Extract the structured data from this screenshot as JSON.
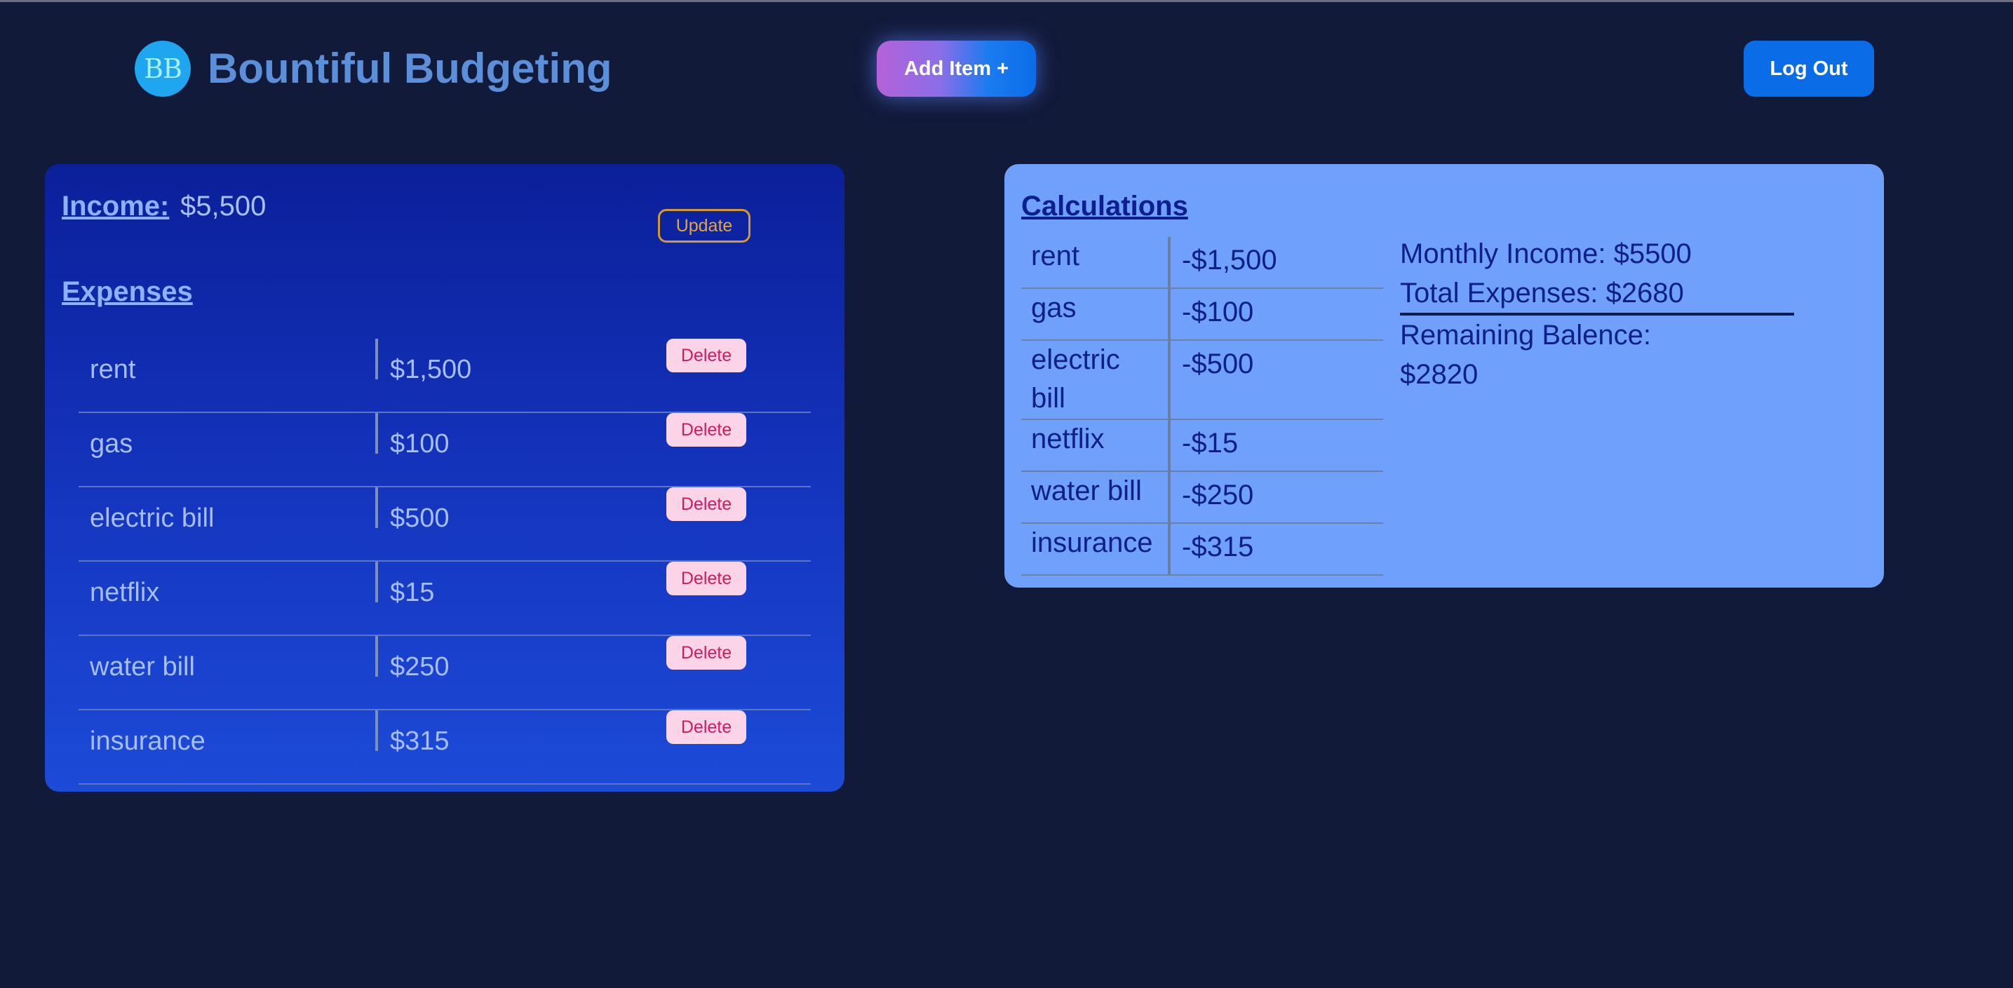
{
  "header": {
    "logo_initials": "BB",
    "title": "Bountiful Budgeting",
    "add_item_label": "Add Item +",
    "logout_label": "Log Out"
  },
  "expenses_panel": {
    "income_label": "Income:",
    "income_value": "$5,500",
    "update_label": "Update",
    "expenses_heading": "Expenses",
    "delete_label": "Delete",
    "items": [
      {
        "name": "rent",
        "amount": "$1,500"
      },
      {
        "name": "gas",
        "amount": "$100"
      },
      {
        "name": "electric bill",
        "amount": "$500"
      },
      {
        "name": "netflix",
        "amount": "$15"
      },
      {
        "name": "water bill",
        "amount": "$250"
      },
      {
        "name": "insurance",
        "amount": "$315"
      }
    ]
  },
  "calculations": {
    "heading": "Calculations",
    "rows": [
      {
        "name": "rent",
        "amount": "-$1,500"
      },
      {
        "name": "gas",
        "amount": "-$100"
      },
      {
        "name": "electric bill",
        "amount": "-$500"
      },
      {
        "name": "netflix",
        "amount": "-$15"
      },
      {
        "name": "water bill",
        "amount": "-$250"
      },
      {
        "name": "insurance",
        "amount": "-$315"
      }
    ],
    "monthly_income": "Monthly Income: $5500",
    "total_expenses": "Total Expenses: $2680",
    "remaining_label": "Remaining Balence:",
    "remaining_value": "$2820"
  },
  "colors": {
    "background": "#121a3a",
    "accent_blue": "#0b6ce8",
    "title_blue": "#5b8fd9",
    "calc_panel": "#6fa0fc",
    "delete_bg": "#fbd5e7",
    "delete_text": "#d6185f",
    "update_border": "#d69a2b"
  },
  "icons": {
    "logo": "bb-logo-icon"
  }
}
